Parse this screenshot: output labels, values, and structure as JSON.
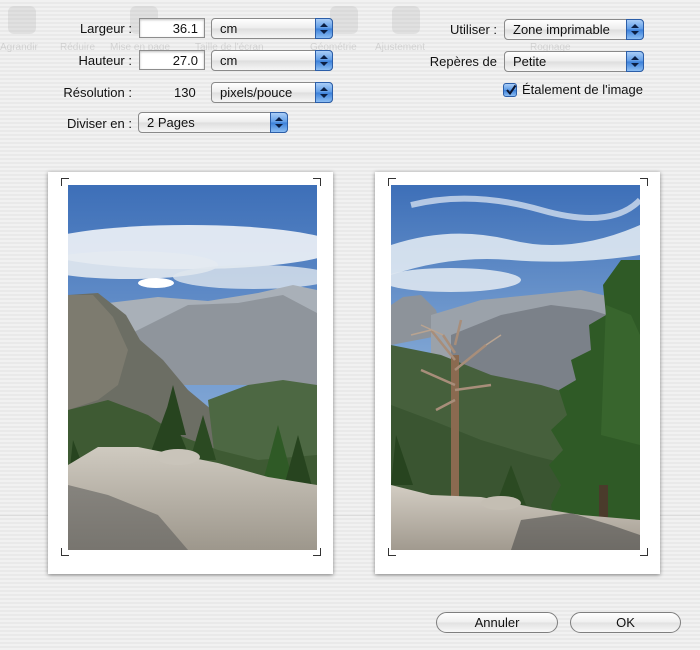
{
  "dimensions": {
    "width_label": "Largeur :",
    "width_value": "36.1",
    "width_unit": "cm",
    "height_label": "Hauteur :",
    "height_value": "27.0",
    "height_unit": "cm",
    "resolution_label": "Résolution :",
    "resolution_value": "130",
    "resolution_unit": "pixels/pouce",
    "divide_label": "Diviser en :",
    "divide_value": "2 Pages"
  },
  "options": {
    "use_label": "Utiliser :",
    "use_value": "Zone imprimable",
    "marks_label": "Repères de",
    "marks_value": "Petite",
    "spread_label": "Étalement de l'image",
    "spread_checked": true
  },
  "background_toolbar": [
    "Agrandir",
    "Réduire",
    "Mise en page",
    "Taille de l'écran",
    "Géométrie",
    "Ajustement",
    "Rognage"
  ],
  "buttons": {
    "cancel": "Annuler",
    "ok": "OK"
  },
  "icons": {
    "popup_arrows": "up-down-arrows-icon",
    "checkbox_mark": "checkmark-icon",
    "crop_marks": "crop-mark-icon"
  },
  "colors": {
    "accent_blue": "#3a7fd9",
    "sky_top": "#3d6fb8",
    "tree_green": "#2f5a26",
    "rock_gray": "#b8b4ab"
  }
}
